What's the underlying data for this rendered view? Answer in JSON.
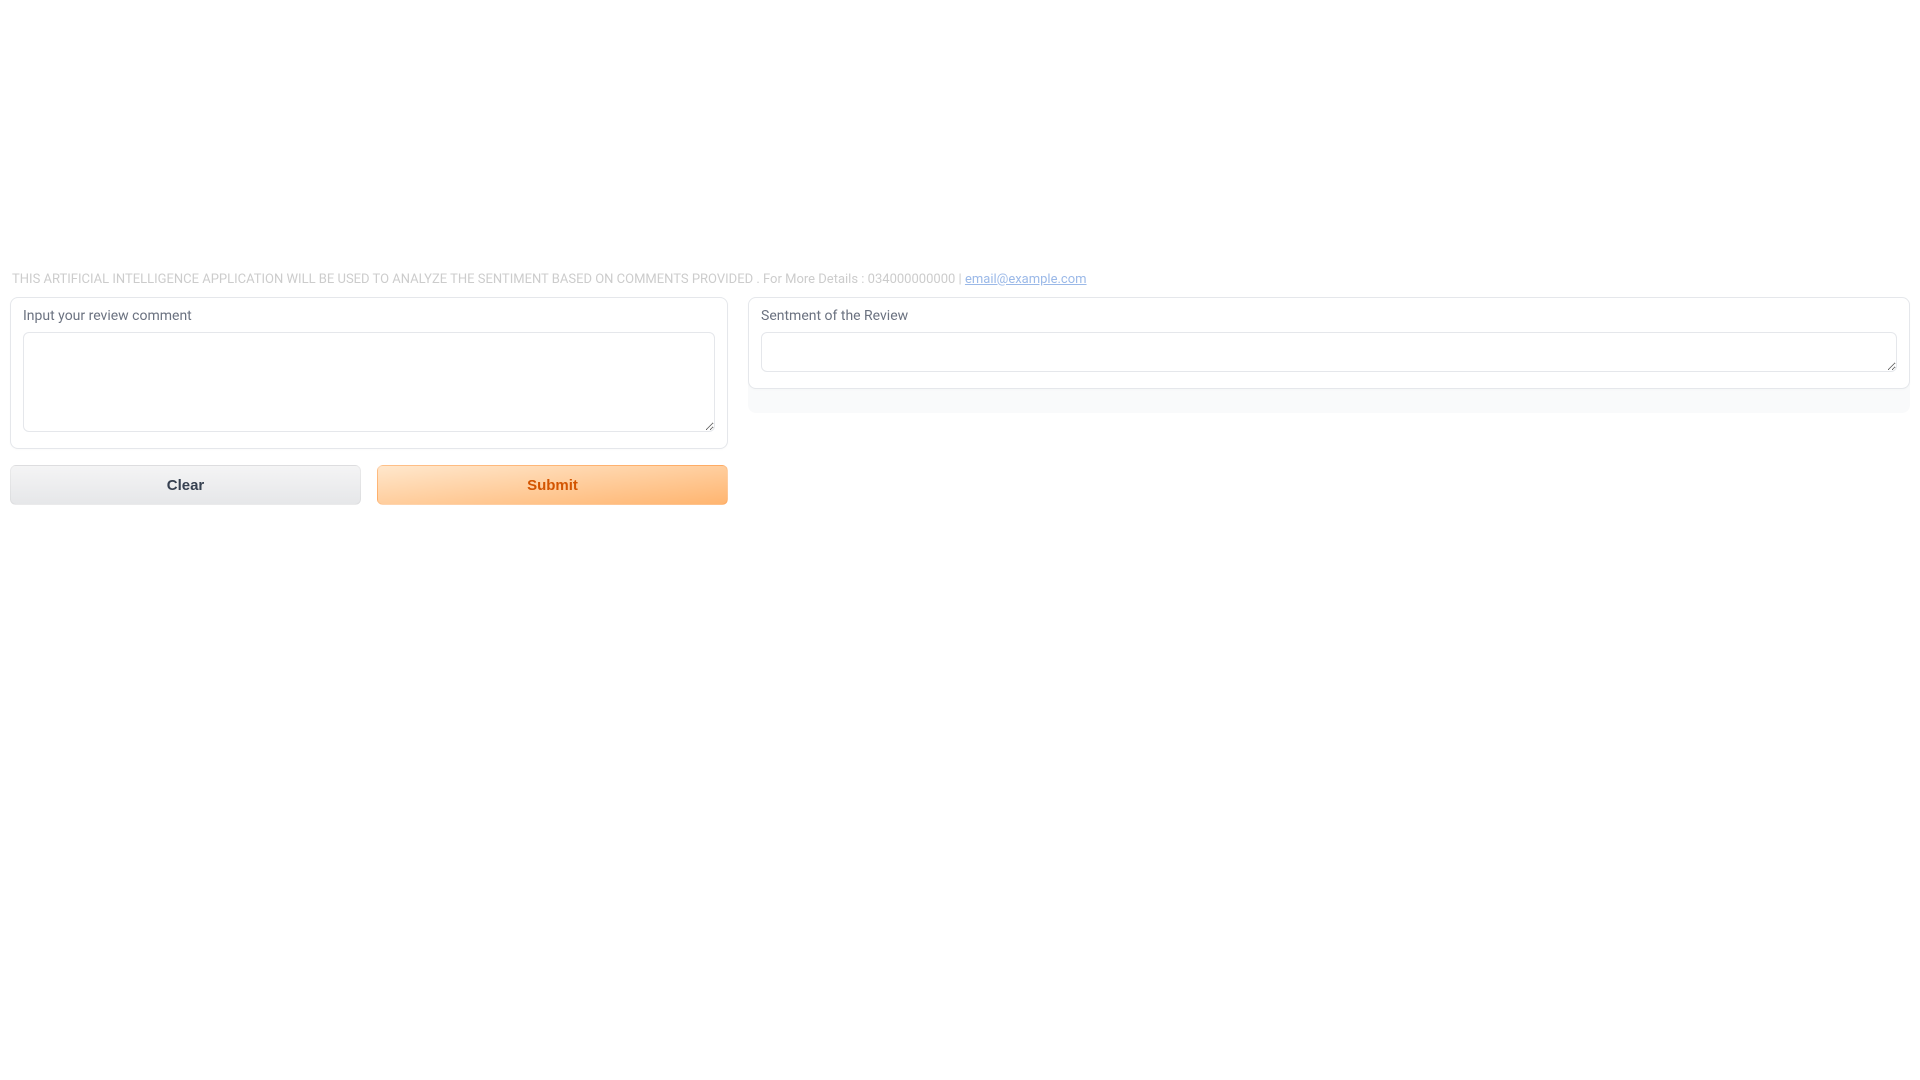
{
  "header": {
    "description_text": "THIS ARTIFICIAL INTELLIGENCE APPLICATION WILL BE USED TO ANALYZE THE SENTIMENT BASED ON COMMENTS PROVIDED . For More Details : 034000000000 | ",
    "link_text": "email@example.com"
  },
  "input_panel": {
    "label": "Input your review comment",
    "value": ""
  },
  "output_panel": {
    "label": "Sentment of the Review",
    "value": ""
  },
  "buttons": {
    "clear_label": "Clear",
    "submit_label": "Submit"
  }
}
